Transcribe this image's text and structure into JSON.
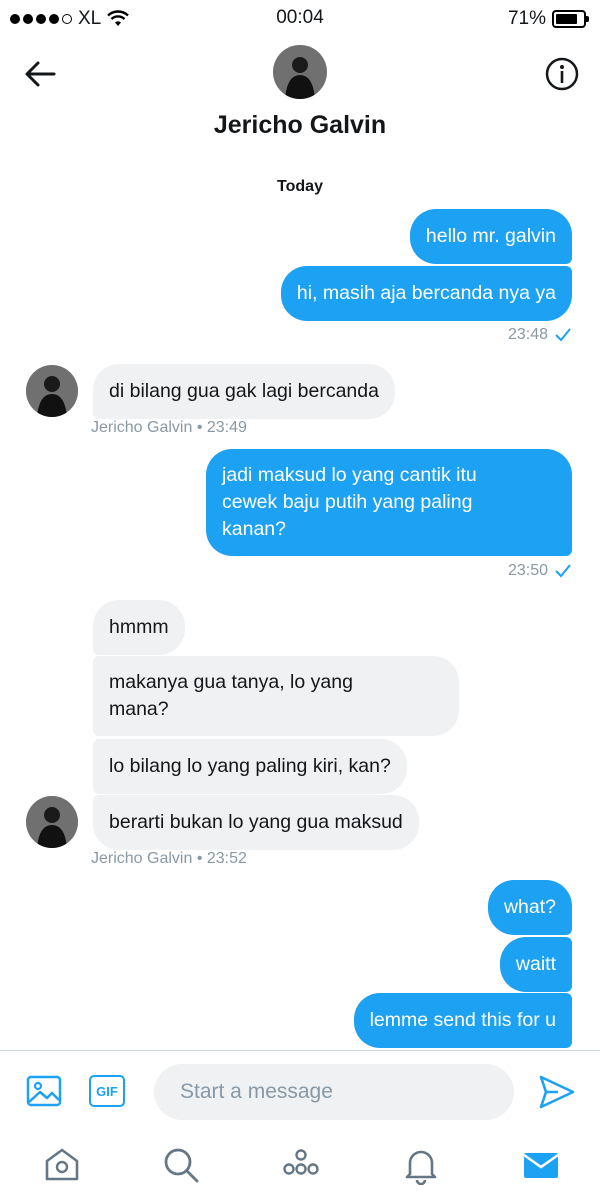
{
  "status": {
    "carrier": "XL",
    "time": "00:04",
    "battery": "71%"
  },
  "header": {
    "name": "Jericho Galvin"
  },
  "day_label": "Today",
  "messages": {
    "m1": "hello mr. galvin",
    "m2": "hi, masih aja bercanda nya ya",
    "t1": "23:48",
    "m3": "di bilang gua gak lagi bercanda",
    "t2": "Jericho Galvin • 23:49",
    "m4_l1": "jadi maksud lo yang cantik itu",
    "m4_l2": "cewek baju putih yang paling",
    "m4_l3": "kanan?",
    "t3": "23:50",
    "m5": "hmmm",
    "m6_l1": "makanya gua tanya, lo yang",
    "m6_l2": "mana?",
    "m7": "lo bilang lo yang paling kiri, kan?",
    "m8": "berarti bukan lo yang gua maksud",
    "t4": "Jericho Galvin • 23:52",
    "m9": "what?",
    "m10": "waitt",
    "m11": "lemme send this for u"
  },
  "composer": {
    "placeholder": "Start a message",
    "gif_label": "GIF"
  },
  "colors": {
    "accent": "#1da1f2",
    "incoming_bg": "#eff1f3",
    "meta": "#8899a6"
  },
  "icons": [
    "back-arrow-icon",
    "info-icon",
    "image-icon",
    "gif-icon",
    "send-icon",
    "home-icon",
    "search-icon",
    "spaces-icon",
    "bell-icon",
    "mail-icon"
  ]
}
